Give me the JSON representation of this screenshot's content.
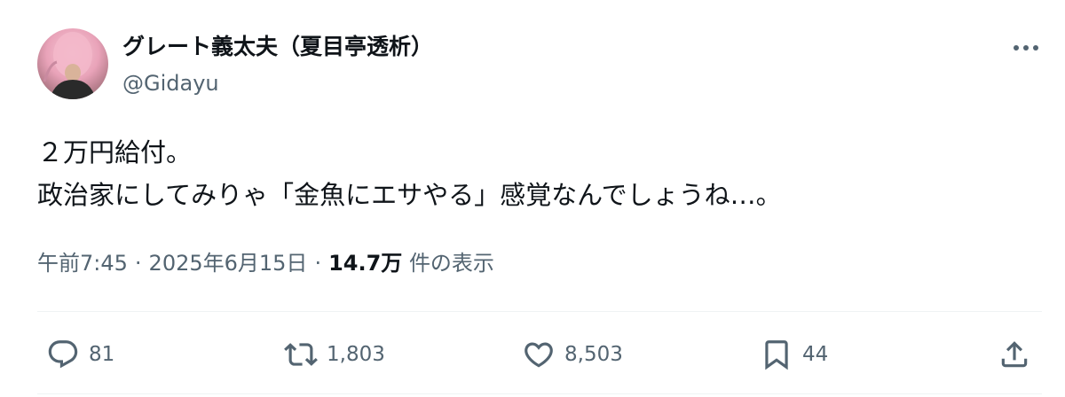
{
  "user": {
    "display_name": "グレート義太夫（夏目亭透析）",
    "handle": "@Gidayu"
  },
  "tweet": {
    "lines": [
      "２万円給付。",
      "政治家にしてみりゃ「金魚にエサやる」感覚なんでしょうね…。"
    ],
    "time": "午前7:45",
    "separator": "·",
    "date": "2025年6月15日",
    "views_count": "14.7万",
    "views_label": "件の表示"
  },
  "actions": {
    "reply": {
      "icon": "reply-icon",
      "count": "81"
    },
    "retweet": {
      "icon": "retweet-icon",
      "count": "1,803"
    },
    "like": {
      "icon": "heart-icon",
      "count": "8,503"
    },
    "bookmark": {
      "icon": "bookmark-icon",
      "count": "44"
    },
    "share": {
      "icon": "share-icon"
    }
  },
  "colors": {
    "text": "#0f1419",
    "secondary": "#536471",
    "divider": "#eff3f4"
  }
}
